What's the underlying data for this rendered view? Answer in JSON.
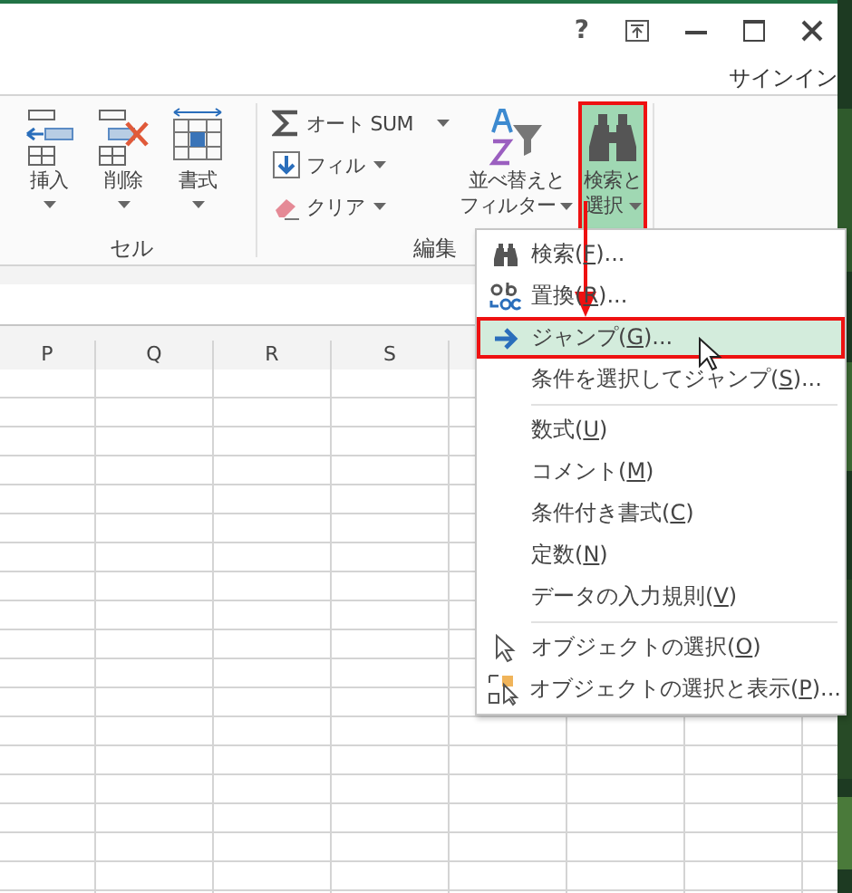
{
  "window": {
    "help": "?",
    "account": "サインイン"
  },
  "ribbon": {
    "groups": [
      {
        "label": "セル",
        "buttons": [
          {
            "kind": "large",
            "label": "挿入",
            "dropdown": true,
            "selected": false,
            "annotated": false
          },
          {
            "kind": "large",
            "label": "削除",
            "dropdown": true,
            "selected": false,
            "annotated": false
          },
          {
            "kind": "large",
            "label": "書式",
            "dropdown": true,
            "selected": false,
            "annotated": false
          }
        ]
      },
      {
        "label": "編集",
        "buttons": [
          {
            "kind": "stack",
            "items": [
              {
                "label": "オート SUM"
              },
              {
                "label": "フィル"
              },
              {
                "label": "クリア"
              }
            ]
          },
          {
            "kind": "large",
            "label": "並べ替えと",
            "label2": "フィルター",
            "dropdown": true,
            "selected": false,
            "annotated": false
          },
          {
            "kind": "large",
            "label": "検索と",
            "label2": "選択",
            "dropdown": true,
            "selected": true,
            "annotated": true
          }
        ]
      }
    ]
  },
  "sheet": {
    "columns": [
      "P",
      "Q",
      "R",
      "S"
    ]
  },
  "menu": {
    "annotation_arrow": true,
    "sections": [
      [
        {
          "text": "検索(",
          "key": "F",
          "after": ")...",
          "selected": false,
          "annotated": false
        },
        {
          "text": "置換(",
          "key": "R",
          "after": ")...",
          "selected": false,
          "annotated": false
        },
        {
          "text": "ジャンプ(",
          "key": "G",
          "after": ")...",
          "selected": true,
          "annotated": true
        },
        {
          "text": "条件を選択してジャンプ(",
          "key": "S",
          "after": ")...",
          "selected": false,
          "annotated": false
        }
      ],
      [
        {
          "text": "数式(",
          "key": "U",
          "after": ")",
          "selected": false,
          "annotated": false
        },
        {
          "text": "コメント(",
          "key": "M",
          "after": ")",
          "selected": false,
          "annotated": false
        },
        {
          "text": "条件付き書式(",
          "key": "C",
          "after": ")",
          "selected": false,
          "annotated": false
        },
        {
          "text": "定数(",
          "key": "N",
          "after": ")",
          "selected": false,
          "annotated": false
        },
        {
          "text": "データの入力規則(",
          "key": "V",
          "after": ")",
          "selected": false,
          "annotated": false
        }
      ],
      [
        {
          "text": "オブジェクトの選択(",
          "key": "O",
          "after": ")",
          "selected": false,
          "annotated": false
        },
        {
          "text": "オブジェクトの選択と表示(",
          "key": "P",
          "after": ")...",
          "selected": false,
          "annotated": false
        }
      ]
    ]
  }
}
